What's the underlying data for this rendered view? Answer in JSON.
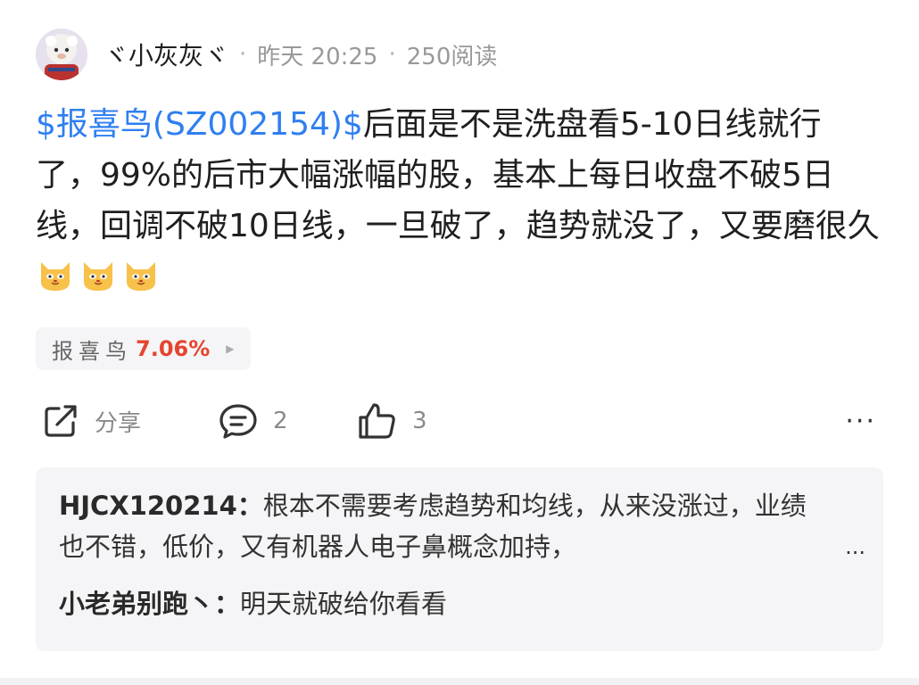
{
  "post": {
    "author": "ヾ小灰灰ヾ",
    "time": "昨天 20:25",
    "reads": "250阅读",
    "separator": "·",
    "stock_tag": "$报喜鸟(SZ002154)$",
    "body_text": "后面是不是洗盘看5-10日线就行了，99%的后市大幅涨幅的股，基本上每日收盘不破5日线，回调不破10日线，一旦破了，趋势就没了，又要磨很久",
    "emojis": [
      "cat-face-icon",
      "cat-face-icon",
      "cat-face-icon"
    ]
  },
  "stock_chip": {
    "name": "报喜鸟",
    "change": "7.06%",
    "change_color": "#e5442e"
  },
  "actions": {
    "share_label": "分享",
    "comment_count": "2",
    "like_count": "3",
    "more_label": "···"
  },
  "comments": [
    {
      "author": "HJCX120214：",
      "text": "根本不需要考虑趋势和均线，从来没涨过，业绩也不错，低价，又有机器人电子鼻概念加持，",
      "more": "..."
    },
    {
      "author": "小老弟别跑丶：",
      "text": "明天就破给你看看"
    }
  ],
  "colors": {
    "link": "#2f7ff1",
    "muted": "#999999",
    "panel_bg": "#f5f5f7"
  }
}
